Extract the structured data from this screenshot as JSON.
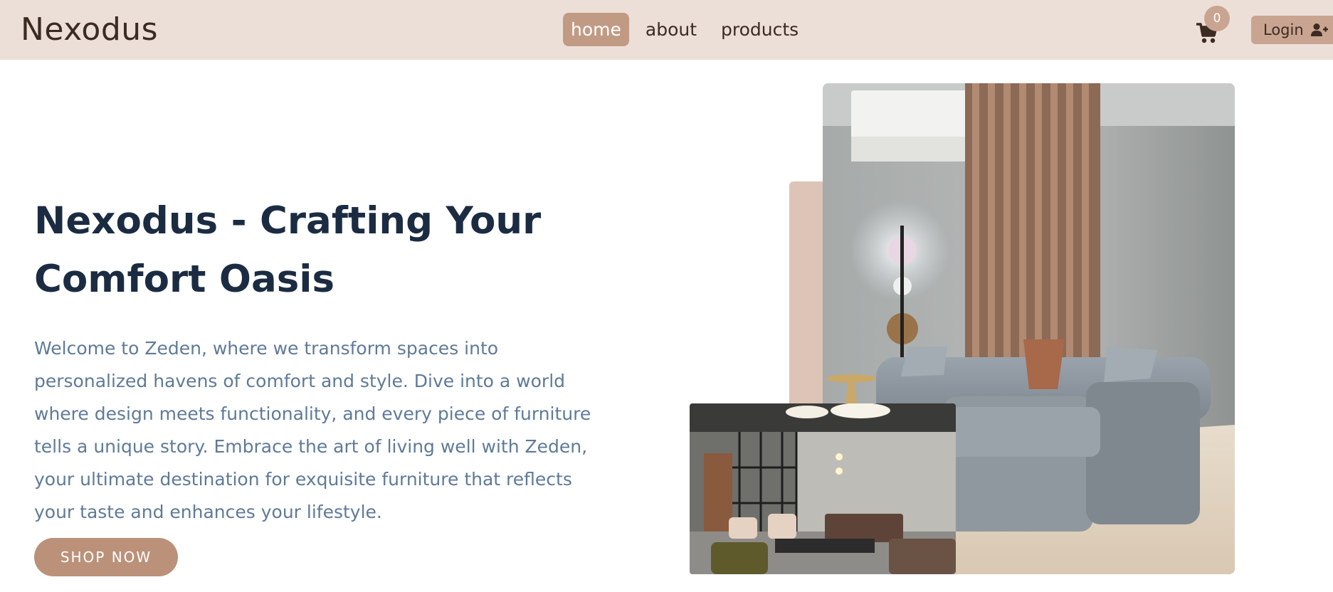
{
  "header": {
    "brand": "Nexodus",
    "nav": [
      {
        "label": "home",
        "active": true
      },
      {
        "label": "about",
        "active": false
      },
      {
        "label": "products",
        "active": false
      }
    ],
    "cart_count": "0",
    "login_label": "Login",
    "icons": [
      "cart-icon",
      "user-plus-icon"
    ]
  },
  "hero": {
    "title_line1": "Nexodus - Crafting Your",
    "title_line2": "Comfort Oasis",
    "description": "Welcome to Zeden, where we transform spaces into personalized havens of comfort and style. Dive into a world where design meets functionality, and every piece of furniture tells a unique story. Embrace the art of living well with Zeden, your ultimate destination for exquisite furniture that reflects your taste and enhances your lifestyle.",
    "cta": "SHOP NOW"
  },
  "colors": {
    "navbar_bg": "#ecdfd8",
    "accent": "#c19a84",
    "title": "#1b2c42",
    "body_text": "#5f7a98"
  }
}
